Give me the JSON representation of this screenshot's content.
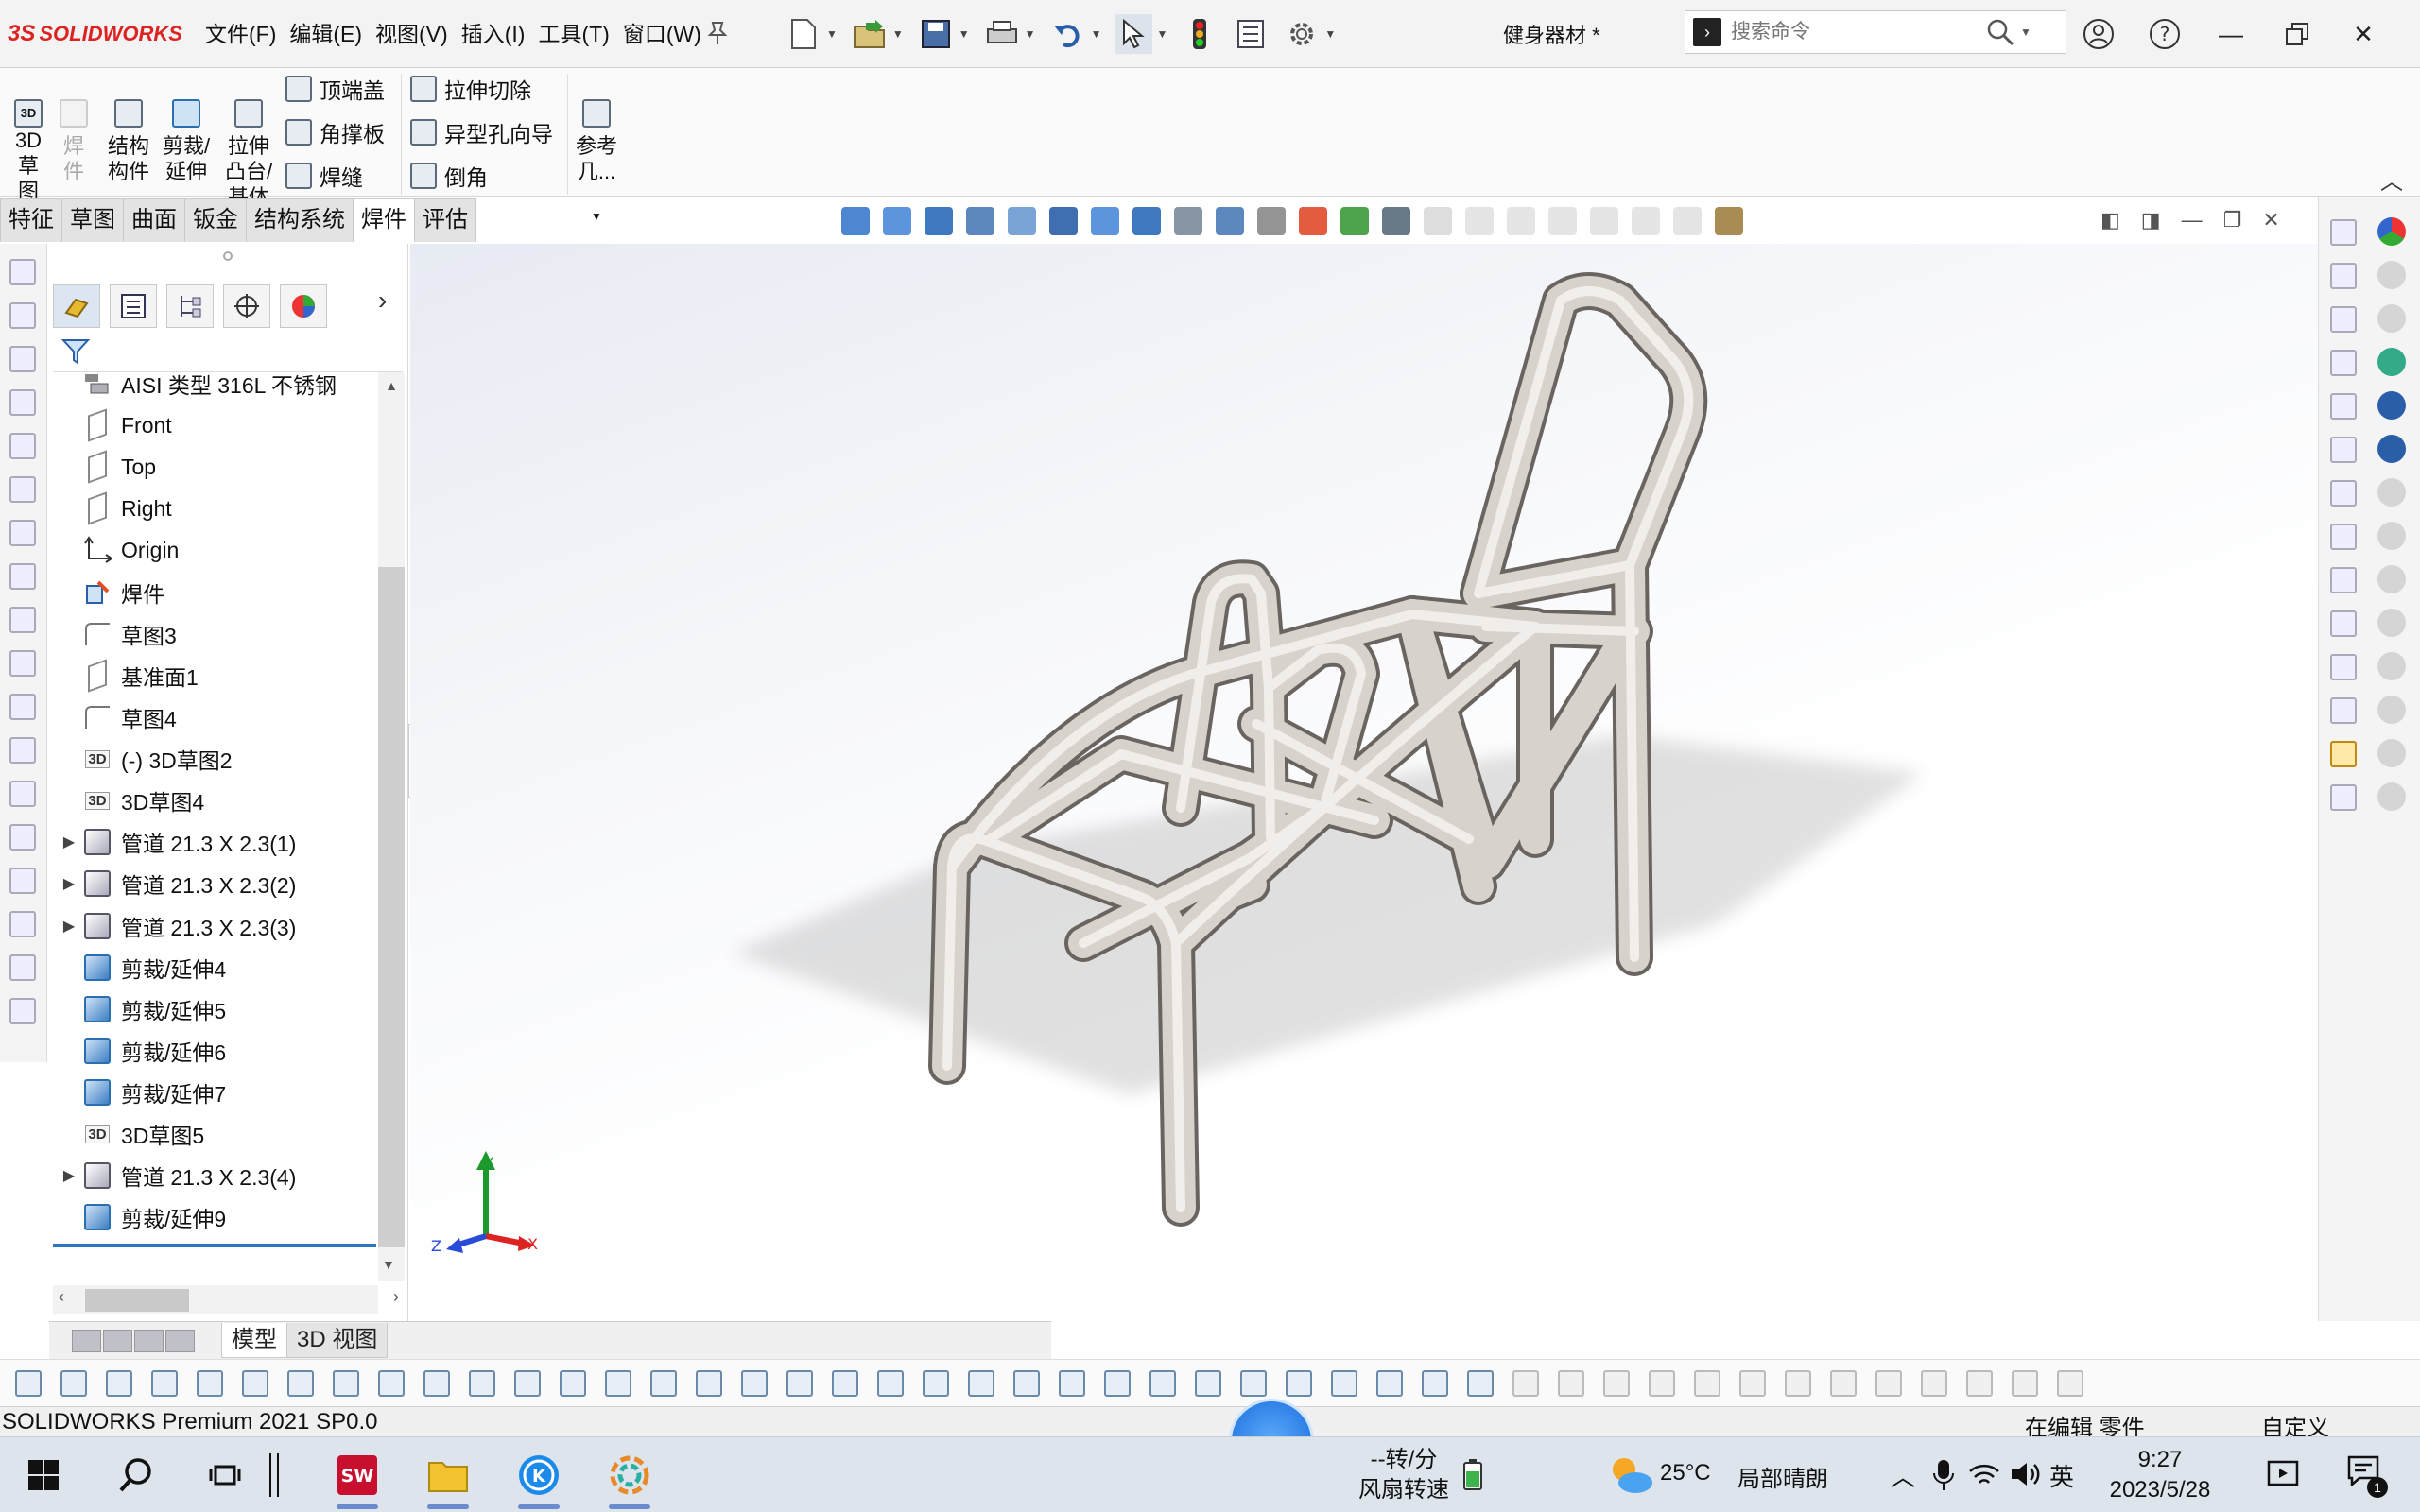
{
  "app": {
    "brand_ds": "3S",
    "brand": "SOLIDWORKS",
    "doc_title": "健身器材 *"
  },
  "menu": [
    "文件(F)",
    "编辑(E)",
    "视图(V)",
    "插入(I)",
    "工具(T)",
    "窗口(W)"
  ],
  "search": {
    "placeholder": "搜索命令"
  },
  "ribbon": {
    "sketch3d": "3D\n草\n图",
    "weldment": "焊\n件",
    "structural": "结构\n构件",
    "trim_extend": "剪裁/\n延伸",
    "boss_base": "拉伸\n凸台/\n基体",
    "end_cap": "顶端盖",
    "gusset": "角撑板",
    "weld_bead": "焊缝",
    "extruded_cut": "拉伸切除",
    "hole_wizard": "异型孔向导",
    "chamfer": "倒角",
    "ref_geometry": "参考\n几..."
  },
  "tabs": [
    "特征",
    "草图",
    "曲面",
    "钣金",
    "结构系统",
    "焊件",
    "评估"
  ],
  "active_tab": 5,
  "tree": [
    {
      "label": "AISI 类型 316L 不锈钢",
      "icon": "material-icon",
      "exp": ""
    },
    {
      "label": "Front",
      "icon": "plane-icon",
      "exp": ""
    },
    {
      "label": "Top",
      "icon": "plane-icon",
      "exp": ""
    },
    {
      "label": "Right",
      "icon": "plane-icon",
      "exp": ""
    },
    {
      "label": "Origin",
      "icon": "origin-icon",
      "exp": ""
    },
    {
      "label": "焊件",
      "icon": "weldment-icon",
      "exp": ""
    },
    {
      "label": "草图3",
      "icon": "sketch-icon",
      "exp": ""
    },
    {
      "label": "基准面1",
      "icon": "plane-icon",
      "exp": ""
    },
    {
      "label": "草图4",
      "icon": "sketch-icon",
      "exp": ""
    },
    {
      "label": "(-) 3D草图2",
      "icon": "sketch3d-icon",
      "exp": ""
    },
    {
      "label": "3D草图4",
      "icon": "sketch3d-icon",
      "exp": ""
    },
    {
      "label": "管道 21.3 X 2.3(1)",
      "icon": "pipe-icon",
      "exp": "▶"
    },
    {
      "label": "管道 21.3 X 2.3(2)",
      "icon": "pipe-icon",
      "exp": "▶"
    },
    {
      "label": "管道 21.3 X 2.3(3)",
      "icon": "pipe-icon",
      "exp": "▶"
    },
    {
      "label": "剪裁/延伸4",
      "icon": "trim-icon",
      "exp": ""
    },
    {
      "label": "剪裁/延伸5",
      "icon": "trim-icon",
      "exp": ""
    },
    {
      "label": "剪裁/延伸6",
      "icon": "trim-icon",
      "exp": ""
    },
    {
      "label": "剪裁/延伸7",
      "icon": "trim-icon",
      "exp": ""
    },
    {
      "label": "3D草图5",
      "icon": "sketch3d-icon",
      "exp": ""
    },
    {
      "label": "管道 21.3 X 2.3(4)",
      "icon": "pipe-icon",
      "exp": "▶"
    },
    {
      "label": "剪裁/延伸9",
      "icon": "trim-icon",
      "exp": ""
    }
  ],
  "triad": {
    "y": "Y",
    "x": "X",
    "z": "Z"
  },
  "bottom_tabs": [
    "模型",
    "3D 视图"
  ],
  "status": {
    "left": "SOLIDWORKS Premium 2021 SP0.0",
    "mode": "在编辑 零件",
    "custom": "自定义"
  },
  "taskbar": {
    "fan_speed": "--转/分",
    "fan_label": "风扇转速",
    "temperature": "25°C",
    "weather": "局部晴朗",
    "ime": "英",
    "time": "9:27",
    "date": "2023/5/28",
    "notif_count": "1"
  },
  "colors": {
    "accent": "#2f75c0",
    "brand": "#d22222",
    "tube": "#d8d2cc"
  }
}
